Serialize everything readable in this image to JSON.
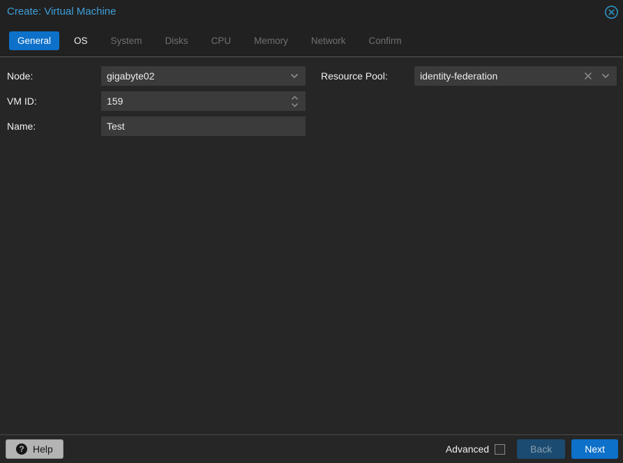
{
  "window": {
    "title": "Create: Virtual Machine"
  },
  "icons": {
    "close": "circle-x-icon",
    "node_dropdown": "chevron-down-icon",
    "vmid_spinner": "chevron-up-down-icons",
    "pool_clear": "x-icon",
    "pool_dropdown": "chevron-down-icon",
    "help": "question-circle-icon",
    "help_glyph": "?"
  },
  "tabs": [
    {
      "label": "General",
      "state": "active"
    },
    {
      "label": "OS",
      "state": "enabled"
    },
    {
      "label": "System",
      "state": "disabled"
    },
    {
      "label": "Disks",
      "state": "disabled"
    },
    {
      "label": "CPU",
      "state": "disabled"
    },
    {
      "label": "Memory",
      "state": "disabled"
    },
    {
      "label": "Network",
      "state": "disabled"
    },
    {
      "label": "Confirm",
      "state": "disabled"
    }
  ],
  "form": {
    "node": {
      "label": "Node:",
      "value": "gigabyte02"
    },
    "vmid": {
      "label": "VM ID:",
      "value": "159"
    },
    "name": {
      "label": "Name:",
      "value": "Test"
    },
    "resource_pool": {
      "label": "Resource Pool:",
      "value": "identity-federation"
    }
  },
  "footer": {
    "help": "Help",
    "advanced": "Advanced",
    "advanced_checked": false,
    "back": "Back",
    "next": "Next"
  },
  "colors": {
    "dialog_bg": "#262626",
    "header_bg": "#212121",
    "title": "#3f9ed8",
    "accent": "#0d70c9",
    "field_bg": "#3b3b3b",
    "field_text": "#ededed",
    "label_text": "#f1f1f1",
    "disabled_tab_text": "#707070",
    "back_button_bg": "#1b4b70",
    "back_button_text": "#8aa0b2",
    "help_button_bg": "#b4b4b4",
    "header_separator": "#585858",
    "footer_separator": "#4a4a4a",
    "close_icon": "#2d93c2"
  }
}
